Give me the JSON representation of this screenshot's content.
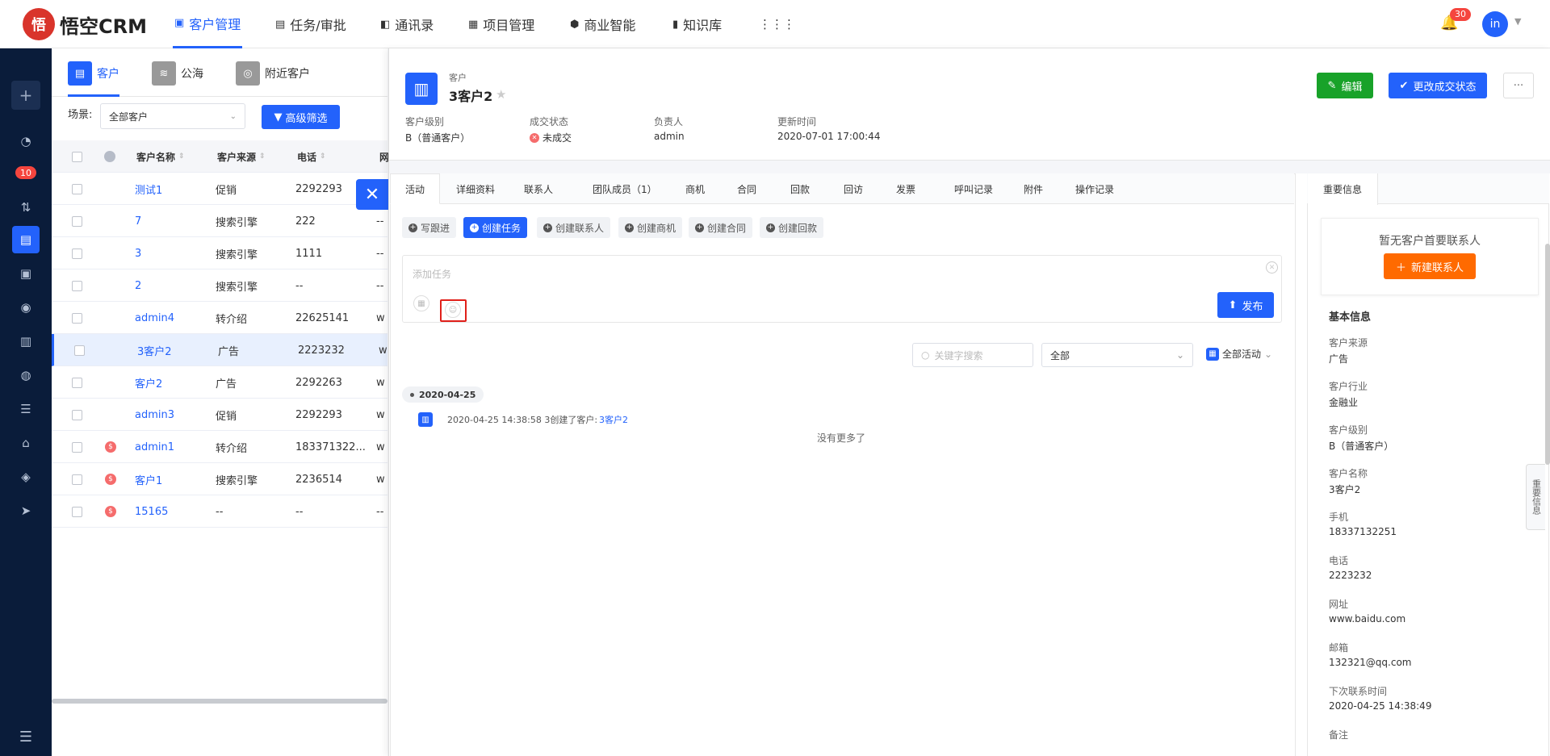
{
  "app": {
    "logo_glyph": "悟",
    "logo_text": "悟空CRM"
  },
  "topnav": {
    "items": [
      {
        "label": "客户管理",
        "active": true
      },
      {
        "label": "任务/审批"
      },
      {
        "label": "通讯录"
      },
      {
        "label": "项目管理"
      },
      {
        "label": "商业智能"
      },
      {
        "label": "知识库"
      }
    ],
    "notifications": "30",
    "avatar": "in"
  },
  "sidebar": {
    "badge": "10"
  },
  "list": {
    "tabs": [
      "客户",
      "公海",
      "附近客户"
    ],
    "scene_label": "场景:",
    "scene_value": "全部客户",
    "filter_button": "高级筛选",
    "headers": [
      "客户名称",
      "客户来源",
      "电话",
      "网"
    ],
    "rows": [
      {
        "name": "测试1",
        "source": "促销",
        "phone": "2292293",
        "web": "",
        "money": false
      },
      {
        "name": "7",
        "source": "搜索引擎",
        "phone": "222",
        "web": "--",
        "money": false
      },
      {
        "name": "3",
        "source": "搜索引擎",
        "phone": "1111",
        "web": "--",
        "money": false
      },
      {
        "name": "2",
        "source": "搜索引擎",
        "phone": "--",
        "web": "--",
        "money": false
      },
      {
        "name": "admin4",
        "source": "转介绍",
        "phone": "22625141",
        "web": "w",
        "money": false
      },
      {
        "name": "3客户2",
        "source": "广告",
        "phone": "2223232",
        "web": "w",
        "money": false,
        "selected": true
      },
      {
        "name": "客户2",
        "source": "广告",
        "phone": "2292263",
        "web": "w",
        "money": false
      },
      {
        "name": "admin3",
        "source": "促销",
        "phone": "2292293",
        "web": "w",
        "money": false
      },
      {
        "name": "admin1",
        "source": "转介绍",
        "phone": "183371322...",
        "web": "w",
        "money": true
      },
      {
        "name": "客户1",
        "source": "搜索引擎",
        "phone": "2236514",
        "web": "w",
        "money": true
      },
      {
        "name": "15165",
        "source": "--",
        "phone": "--",
        "web": "--",
        "money": true
      }
    ]
  },
  "detail": {
    "type_label": "客户",
    "name": "3客户2",
    "edit_button": "编辑",
    "status_button": "更改成交状态",
    "more": "···",
    "fields": [
      {
        "label": "客户级别",
        "value": "B（普通客户）"
      },
      {
        "label": "成交状态",
        "value": "未成交"
      },
      {
        "label": "负责人",
        "value": "admin"
      },
      {
        "label": "更新时间",
        "value": "2020-07-01 17:00:44"
      }
    ],
    "tabs": [
      "活动",
      "详细资料",
      "联系人",
      "团队成员（1）",
      "商机",
      "合同",
      "回款",
      "回访",
      "发票",
      "呼叫记录",
      "附件",
      "操作记录"
    ],
    "actions": [
      "写跟进",
      "创建任务",
      "创建联系人",
      "创建商机",
      "创建合同",
      "创建回款"
    ],
    "task_placeholder": "添加任务",
    "publish_button": "发布",
    "search_placeholder": "关键字搜索",
    "filter_value": "全部",
    "activity_filter": "全部活动",
    "timeline_date": "2020-04-25",
    "timeline_entry_text": "2020-04-25 14:38:58 3创建了客户:",
    "timeline_entry_link": "3客户2",
    "no_more": "没有更多了"
  },
  "right": {
    "tab": "重要信息",
    "no_contact": "暂无客户首要联系人",
    "new_contact_button": "新建联系人",
    "section_title": "基本信息",
    "fields": [
      {
        "label": "客户来源",
        "value": "广告"
      },
      {
        "label": "客户行业",
        "value": "金融业"
      },
      {
        "label": "客户级别",
        "value": "B（普通客户）"
      },
      {
        "label": "客户名称",
        "value": "3客户2"
      },
      {
        "label": "手机",
        "value": "18337132251"
      },
      {
        "label": "电话",
        "value": "2223232"
      },
      {
        "label": "网址",
        "value": "www.baidu.com"
      },
      {
        "label": "邮箱",
        "value": "132321@qq.com"
      },
      {
        "label": "下次联系时间",
        "value": "2020-04-25 14:38:49"
      },
      {
        "label": "备注",
        "value": ""
      }
    ],
    "side_tab": "重要信息"
  }
}
